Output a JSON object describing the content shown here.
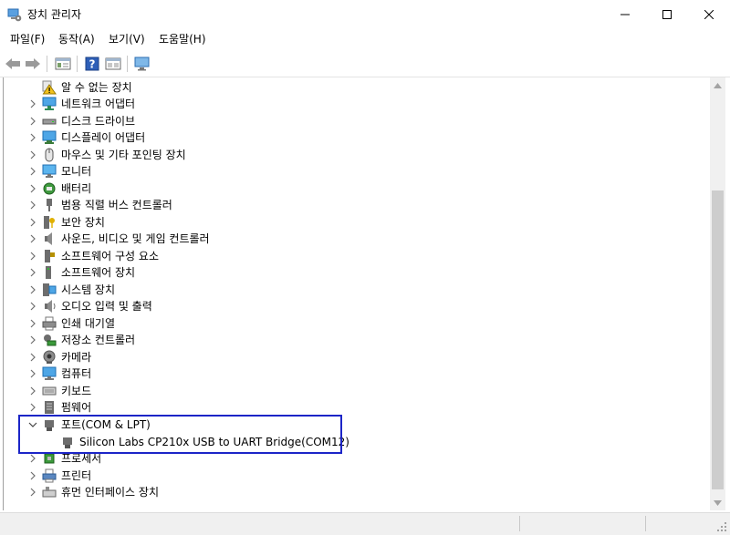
{
  "window": {
    "title": "장치 관리자"
  },
  "menu": [
    {
      "label": "파일(F)"
    },
    {
      "label": "동작(A)"
    },
    {
      "label": "보기(V)"
    },
    {
      "label": "도움말(H)"
    }
  ],
  "tree": {
    "rows": [
      {
        "label": "알 수 없는 장치",
        "icon": "unknown-device-warning-icon",
        "expanded": null,
        "child": false
      },
      {
        "label": "네트워크 어댑터",
        "icon": "network-adapter-icon",
        "expanded": false,
        "child": false
      },
      {
        "label": "디스크 드라이브",
        "icon": "disk-drive-icon",
        "expanded": false,
        "child": false
      },
      {
        "label": "디스플레이 어댑터",
        "icon": "display-adapter-icon",
        "expanded": false,
        "child": false
      },
      {
        "label": "마우스 및 기타 포인팅 장치",
        "icon": "mouse-icon",
        "expanded": false,
        "child": false
      },
      {
        "label": "모니터",
        "icon": "monitor-icon",
        "expanded": false,
        "child": false
      },
      {
        "label": "배터리",
        "icon": "battery-icon",
        "expanded": false,
        "child": false
      },
      {
        "label": "범용 직렬 버스 컨트롤러",
        "icon": "usb-controller-icon",
        "expanded": false,
        "child": false
      },
      {
        "label": "보안 장치",
        "icon": "security-device-icon",
        "expanded": false,
        "child": false
      },
      {
        "label": "사운드, 비디오 및 게임 컨트롤러",
        "icon": "sound-icon",
        "expanded": false,
        "child": false
      },
      {
        "label": "소프트웨어 구성 요소",
        "icon": "software-component-icon",
        "expanded": false,
        "child": false
      },
      {
        "label": "소프트웨어 장치",
        "icon": "software-device-icon",
        "expanded": false,
        "child": false
      },
      {
        "label": "시스템 장치",
        "icon": "system-device-icon",
        "expanded": false,
        "child": false
      },
      {
        "label": "오디오 입력 및 출력",
        "icon": "audio-io-icon",
        "expanded": false,
        "child": false
      },
      {
        "label": "인쇄 대기열",
        "icon": "print-queue-icon",
        "expanded": false,
        "child": false
      },
      {
        "label": "저장소 컨트롤러",
        "icon": "storage-controller-icon",
        "expanded": false,
        "child": false
      },
      {
        "label": "카메라",
        "icon": "camera-icon",
        "expanded": false,
        "child": false
      },
      {
        "label": "컴퓨터",
        "icon": "computer-icon",
        "expanded": false,
        "child": false
      },
      {
        "label": "키보드",
        "icon": "keyboard-icon",
        "expanded": false,
        "child": false
      },
      {
        "label": "펌웨어",
        "icon": "firmware-icon",
        "expanded": false,
        "child": false
      },
      {
        "label": "포트(COM & LPT)",
        "icon": "port-icon",
        "expanded": true,
        "child": false
      },
      {
        "label": "Silicon Labs CP210x USB to UART Bridge(COM12)",
        "icon": "port-icon",
        "expanded": null,
        "child": true
      },
      {
        "label": "프로세서",
        "icon": "processor-icon",
        "expanded": false,
        "child": false
      },
      {
        "label": "프린터",
        "icon": "printer-icon",
        "expanded": false,
        "child": false
      },
      {
        "label": "휴먼 인터페이스 장치",
        "icon": "hid-icon",
        "expanded": false,
        "child": false
      }
    ]
  },
  "colors": {
    "highlight_box": "#1c25c7",
    "window_bg": "#ffffff",
    "chrome_bg": "#f0f0f0"
  }
}
